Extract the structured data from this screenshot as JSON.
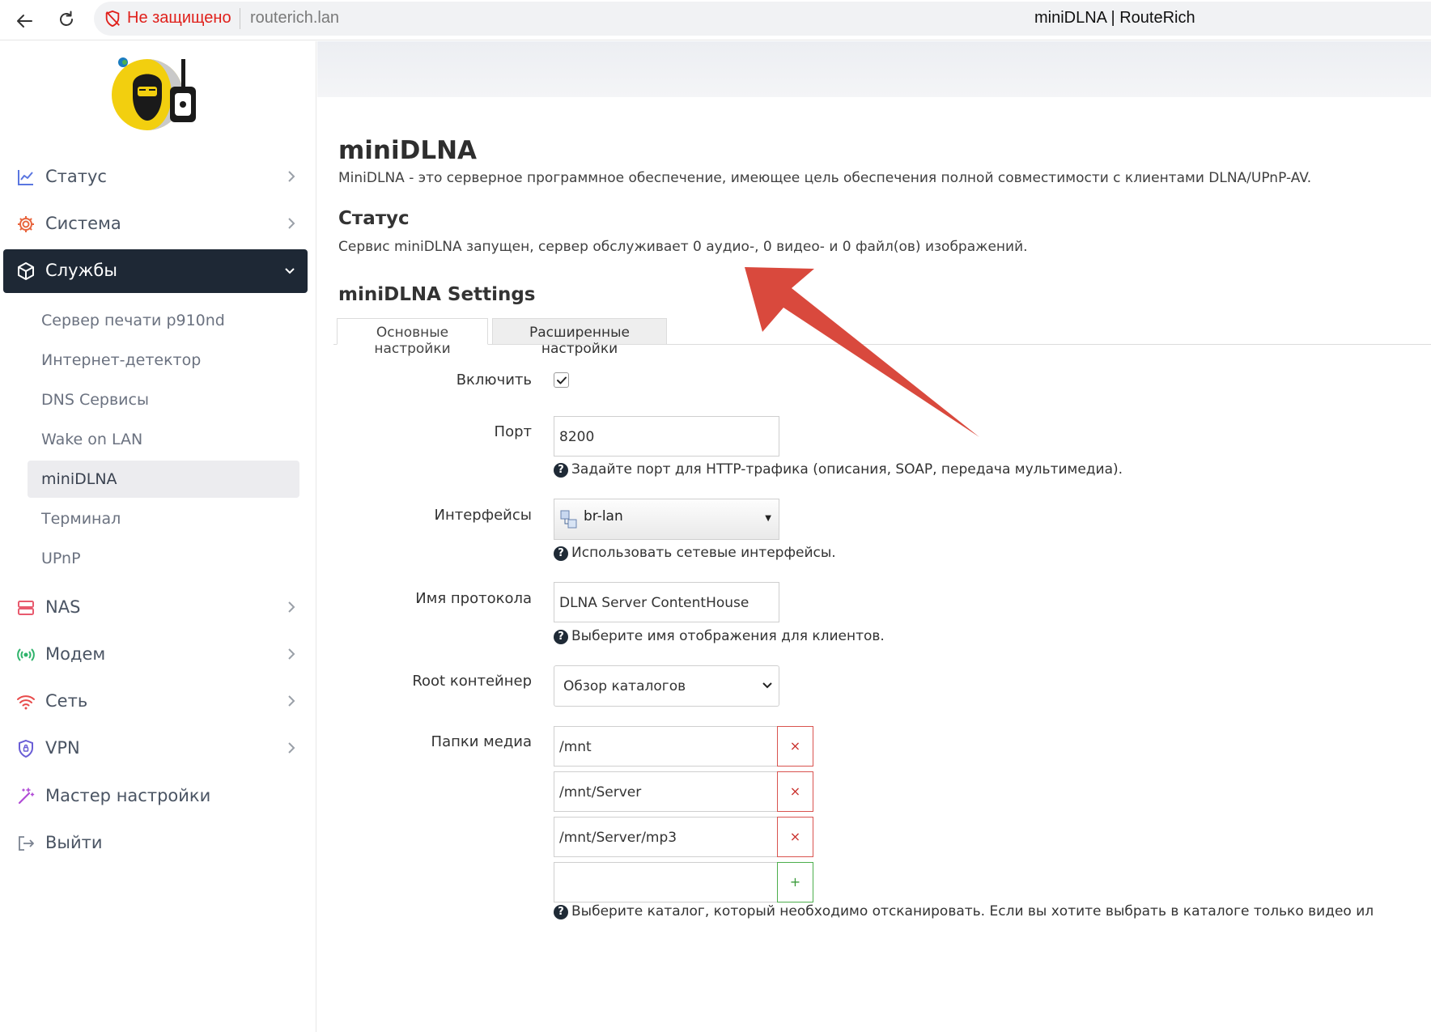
{
  "browser": {
    "not_secure": "Не защищено",
    "url": "routerich.lan",
    "title": "miniDLNA | RouteRich"
  },
  "sidebar": {
    "menu": [
      {
        "label": "Статус",
        "icon": "chart-line-icon"
      },
      {
        "label": "Система",
        "icon": "gear-icon"
      },
      {
        "label": "Службы",
        "icon": "box-icon",
        "active": true
      },
      {
        "label": "NAS",
        "icon": "server-icon"
      },
      {
        "label": "Модем",
        "icon": "broadcast-icon"
      },
      {
        "label": "Сеть",
        "icon": "wifi-icon"
      },
      {
        "label": "VPN",
        "icon": "shield-lock-icon"
      },
      {
        "label": "Мастер настройки",
        "icon": "magic-wand-icon"
      },
      {
        "label": "Выйти",
        "icon": "logout-icon"
      }
    ],
    "services_submenu": [
      "Сервер печати p910nd",
      "Интернет-детектор",
      "DNS Сервисы",
      "Wake on LAN",
      "miniDLNA",
      "Терминал",
      "UPnP"
    ],
    "current_submenu": "miniDLNA"
  },
  "main": {
    "title": "miniDLNA",
    "description": "MiniDLNA - это серверное программное обеспечение, имеющее цель обеспечения полной совместимости с клиентами DLNA/UPnP-AV.",
    "status_heading": "Статус",
    "status_text": "Сервис miniDLNA запущен, сервер обслуживает 0 аудио-, 0 видео- и 0 файл(ов) изображений.",
    "settings_heading": "miniDLNA Settings",
    "tabs": [
      {
        "label": "Основные настройки",
        "active": true
      },
      {
        "label": "Расширенные настройки",
        "active": false
      }
    ],
    "fields": {
      "enable": {
        "label": "Включить",
        "checked": true
      },
      "port": {
        "label": "Порт",
        "value": "8200",
        "help": "Задайте порт для HTTP-трафика (описания, SOAP, передача мультимедиа)."
      },
      "interfaces": {
        "label": "Интерфейсы",
        "value": "br-lan",
        "help": "Использовать сетевые интерфейсы."
      },
      "friendly_name": {
        "label": "Имя протокола",
        "value": "DLNA Server ContentHouse",
        "help": "Выберите имя отображения для клиентов."
      },
      "root_container": {
        "label": "Root контейнер",
        "value": "Обзор каталогов"
      },
      "media_dirs": {
        "label": "Папки медиа",
        "values": [
          "/mnt",
          "/mnt/Server",
          "/mnt/Server/mp3",
          ""
        ],
        "remove_symbol": "×",
        "add_symbol": "+",
        "help": "Выберите каталог, который необходимо отсканировать. Если вы хотите выбрать в каталоге только видео ил"
      }
    }
  },
  "colors": {
    "sidebar_active_bg": "#1e2835",
    "not_secure_red": "#e0201b",
    "annotation_arrow": "#d9493d",
    "remove_button": "#d9534f",
    "add_button": "#4cae4c"
  }
}
